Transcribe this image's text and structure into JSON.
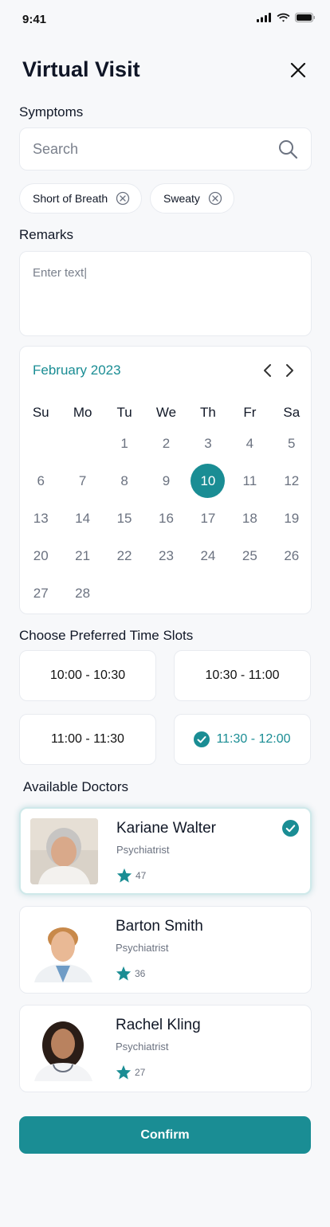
{
  "status": {
    "time": "9:41"
  },
  "title": "Virtual Visit",
  "symptoms": {
    "label": "Symptoms",
    "search_placeholder": "Search",
    "chips": [
      "Short of Breath",
      "Sweaty"
    ]
  },
  "remarks": {
    "label": "Remarks",
    "placeholder": "Enter text|"
  },
  "calendar": {
    "month": "February 2023",
    "weekdays": [
      "Su",
      "Mo",
      "Tu",
      "We",
      "Th",
      "Fr",
      "Sa"
    ],
    "days": [
      "",
      "",
      "1",
      "2",
      "3",
      "4",
      "5",
      "6",
      "7",
      "8",
      "9",
      "10",
      "11",
      "12",
      "13",
      "14",
      "15",
      "16",
      "17",
      "18",
      "19",
      "20",
      "21",
      "22",
      "23",
      "24",
      "25",
      "26",
      "27",
      "28"
    ],
    "selected": "10"
  },
  "timeslots": {
    "label": "Choose Preferred Time Slots",
    "slots": [
      "10:00 - 10:30",
      "10:30 - 11:00",
      "11:00 - 11:30",
      "11:30 - 12:00"
    ],
    "selected": "11:30 - 12:00"
  },
  "doctors": {
    "label": "Available Doctors",
    "items": [
      {
        "name": "Kariane Walter",
        "role": "Psychiatrist",
        "rating": "47"
      },
      {
        "name": "Barton Smith",
        "role": "Psychiatrist",
        "rating": "36"
      },
      {
        "name": "Rachel Kling",
        "role": "Psychiatrist",
        "rating": "27"
      }
    ],
    "selected": "Kariane Walter"
  },
  "confirm_label": "Confirm",
  "colors": {
    "accent": "#1a8d94",
    "background": "#f7f8fa"
  }
}
